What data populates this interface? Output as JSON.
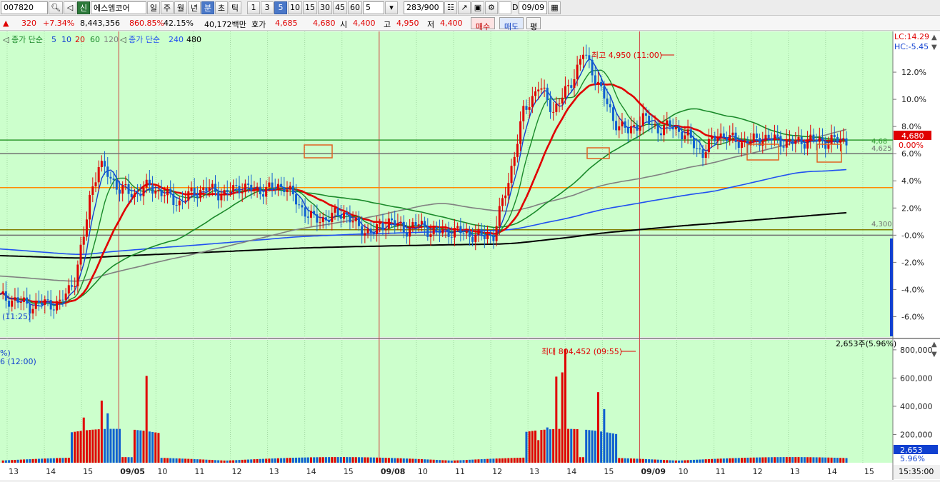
{
  "toolbar": {
    "code": "007820",
    "stock_name": "에스엠코어",
    "credit_badge": "신",
    "periods": [
      "일",
      "주",
      "월",
      "년",
      "분",
      "초",
      "틱"
    ],
    "active_period": "분",
    "intervals": [
      "1",
      "3",
      "5",
      "10",
      "15",
      "30",
      "45",
      "60"
    ],
    "active_interval": "5",
    "interval_select": "5",
    "count": "283/900",
    "date_label": "D",
    "date": "09/09"
  },
  "quote": {
    "change": "320",
    "change_rate": "+7.34%",
    "volume": "8,443,356",
    "volume_ratio": "860.85%",
    "turnover_rate": "42.15%",
    "amount": "40,172백만",
    "ask_label": "호가",
    "ask": "4,685",
    "bid": "4,680",
    "open_label": "시",
    "open": "4,400",
    "high_label": "고",
    "high": "4,950",
    "low_label": "저",
    "low": "4,400",
    "buy_btn": "매수",
    "sell_btn": "매도",
    "eval_btn": "평"
  },
  "colors": {
    "chart_bg": "#ccffcc",
    "up": "#e00000",
    "down": "#1060d0",
    "ma5": "#1040d0",
    "ma10": "#1a8a2a",
    "ma20": "#e00000",
    "ma60": "#1a8a2a",
    "ma120": "#808080",
    "ma240": "#2050f0",
    "ma480": "#000000",
    "hline_orange": "#ff8c00",
    "hline_green": "#2e9a2e",
    "hline_gray": "#707070",
    "hline_olive": "#808000"
  },
  "legend": {
    "text1": "종가 단순",
    "n5": "5",
    "n10": "10",
    "n20": "20",
    "n60": "60",
    "n120": "120",
    "text2": "종가 단순",
    "n240": "240",
    "n480": "480"
  },
  "labels": {
    "lc": "LC:14.29",
    "hc": "HC:-5.45",
    "high_annot": "최고 4,950 (11:00)",
    "left_time": "(11:25)",
    "max_vol_annot": "최대 804,452 (09:55)",
    "vol_left_time": "6 (12:00)",
    "vol_left_pct": "%)",
    "vol_status": "2,653주(5.96%)",
    "last_price": "4,680",
    "last_pct": "0.00%",
    "level_4685": "4,68",
    "level_4625": "4,625",
    "level_4300": "4,300",
    "last_volume": "2,653",
    "last_vol_pct": "5.96%",
    "clock": "15:35:00"
  },
  "chart_data": [
    {
      "type": "candlestick",
      "y_unit": "% change",
      "ylim": [
        -7.5,
        15
      ],
      "yticks": [
        "12.0%",
        "10.0%",
        "8.0%",
        "6.0%",
        "4.0%",
        "2.0%",
        "-0.0%",
        "-2.0%",
        "-4.0%",
        "-6.0%"
      ],
      "ytick_values": [
        12,
        10,
        8,
        6,
        4,
        2,
        0,
        -2,
        -4,
        -6
      ],
      "x_tick_labels": [
        "13",
        "14",
        "15",
        "09/05",
        "10",
        "11",
        "12",
        "13",
        "14",
        "15",
        "09/08",
        "10",
        "11",
        "12",
        "13",
        "14",
        "15",
        "09/09",
        "10",
        "11",
        "12",
        "13",
        "14",
        "15"
      ],
      "session_separators": [
        "09/05",
        "09/08",
        "09/09"
      ],
      "series": [
        {
          "name": "close",
          "x": [
            0,
            5,
            10,
            15,
            20,
            25,
            28,
            30,
            33,
            36,
            40,
            45,
            50,
            55,
            60,
            65,
            70,
            75,
            80,
            85,
            90,
            95,
            100,
            105,
            110,
            115,
            120,
            125,
            130,
            135,
            140,
            145,
            150,
            155,
            160,
            165,
            170,
            175,
            180,
            185,
            190,
            195,
            200,
            205,
            210,
            215,
            220,
            225,
            230,
            235,
            240,
            245,
            250,
            255,
            260,
            265,
            270,
            275,
            283
          ],
          "values": [
            -4.6,
            -4.8,
            -5.2,
            -5.0,
            -5.1,
            -3.2,
            -0.2,
            2.8,
            5.2,
            4.5,
            3.4,
            3.0,
            3.6,
            3.0,
            2.4,
            3.2,
            3.4,
            3.0,
            3.6,
            3.3,
            3.4,
            3.7,
            2.2,
            1.1,
            1.3,
            1.7,
            0.5,
            0.2,
            1.1,
            0.4,
            0.8,
            0.2,
            0.3,
            0.2,
            -0.1,
            0.0,
            4.0,
            9.0,
            11.0,
            9.2,
            10.8,
            13.4,
            11.2,
            8.5,
            7.6,
            8.6,
            7.8,
            8.0,
            7.2,
            6.0,
            7.5,
            7.0,
            6.8,
            7.2,
            7.0,
            6.8,
            7.0,
            6.9,
            7.0
          ]
        }
      ],
      "horizontal_levels": [
        {
          "value": 7.0,
          "color": "#2e9a2e"
        },
        {
          "value": 6.0,
          "color": "#707070"
        },
        {
          "value": 3.5,
          "color": "#ff8c00"
        },
        {
          "value": 0.4,
          "color": "#808000"
        },
        {
          "value": 0.0,
          "color": "#707070"
        }
      ],
      "annotations": [
        {
          "text": "최고 4,950 (11:00)",
          "x": 195,
          "y": 13.4
        }
      ]
    },
    {
      "type": "bar",
      "ylabel": "volume",
      "ylim": [
        0,
        850000
      ],
      "yticks": [
        "800,000",
        "600,000",
        "400,000",
        "200,000"
      ],
      "ytick_values": [
        800000,
        600000,
        400000,
        200000
      ],
      "max_label": "최대 804,452 (09:55)",
      "peak_values": [
        {
          "x": 28,
          "value": 320000
        },
        {
          "x": 34,
          "value": 440000
        },
        {
          "x": 36,
          "value": 350000
        },
        {
          "x": 49,
          "value": 615000
        },
        {
          "x": 180,
          "value": 160000
        },
        {
          "x": 183,
          "value": 250000
        },
        {
          "x": 186,
          "value": 610000
        },
        {
          "x": 188,
          "value": 640000
        },
        {
          "x": 189,
          "value": 804452
        },
        {
          "x": 200,
          "value": 500000
        },
        {
          "x": 202,
          "value": 380000
        }
      ]
    }
  ]
}
